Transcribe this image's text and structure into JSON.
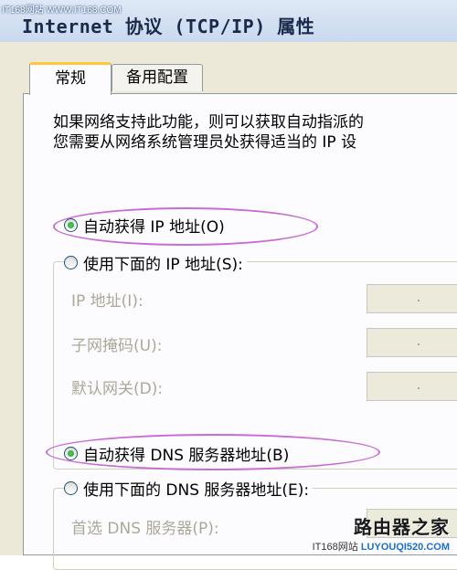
{
  "window": {
    "site_tag": "IT168网站 WWW.IT168.COM",
    "title": "Internet 协议 (TCP/IP) 属性"
  },
  "tabs": [
    {
      "label": "常规",
      "active": true
    },
    {
      "label": "备用配置",
      "active": false
    }
  ],
  "description": {
    "line1": "如果网络支持此功能，则可以获取自动指派的",
    "line2": "您需要从网络系统管理员处获得适当的 IP 设"
  },
  "ip_section": {
    "auto_label": "自动获得 IP 地址(O)",
    "auto_selected": true,
    "manual_label": "使用下面的 IP 地址(S):",
    "manual_selected": false,
    "fields": [
      {
        "label": "IP 地址(I):",
        "value": ""
      },
      {
        "label": "子网掩码(U):",
        "value": ""
      },
      {
        "label": "默认网关(D):",
        "value": ""
      }
    ]
  },
  "dns_section": {
    "auto_label": "自动获得 DNS 服务器地址(B)",
    "auto_selected": true,
    "manual_label": "使用下面的 DNS 服务器地址(E):",
    "manual_selected": false,
    "fields": [
      {
        "label": "首选 DNS 服务器(P):",
        "value": ""
      }
    ]
  },
  "highlight_color": "#c86cd4",
  "watermark": {
    "main": "路由器之家",
    "sub_left": "IT168网站",
    "sub_right": "LUYOUQI520.COM"
  }
}
